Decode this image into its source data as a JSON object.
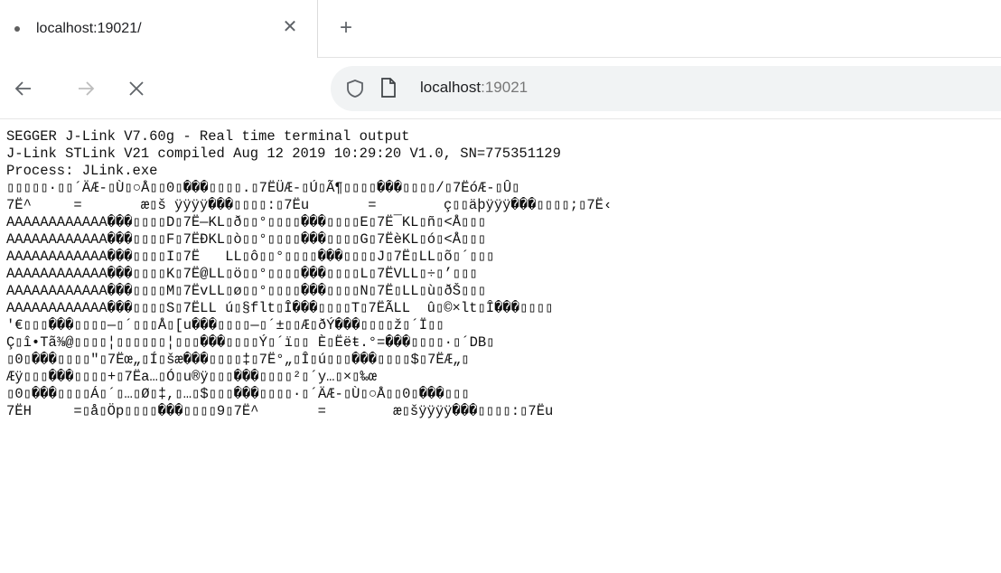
{
  "tab": {
    "title": "localhost:19021/",
    "close_icon": "close-icon",
    "new_tab_icon": "plus-icon"
  },
  "nav": {
    "back_icon": "arrow-left-icon",
    "forward_icon": "arrow-right-icon",
    "close_icon": "close-icon"
  },
  "address": {
    "host": "localhost",
    "port": ":19021",
    "security_icon": "shield-icon",
    "page_icon": "page-icon"
  },
  "terminal": {
    "lines": [
      "SEGGER J-Link V7.60g - Real time terminal output",
      "J-Link STLink V21 compiled Aug 12 2019 10:29:20 V1.0, SN=775351129",
      "Process: JLink.exe",
      "▯▯▯▯▯·▯▯´ÄÆ-▯Ù▯○Å▯▯0▯���▯▯▯▯.▯7ËÜÆ-▯Ú▯Ã¶▯▯▯▯���▯▯▯▯/▯7ËóÆ-▯Û▯",
      "7Ë^     =       æ▯š ÿÿÿÿ���▯▯▯▯:▯7Ëu       =        ç▯▯äþÿÿÿ���▯▯▯▯;▯7Ë‹",
      "AAAAAAAAAAAA���▯▯▯▯D▯7Ë—KL▯ð▯▯°▯▯▯▯���▯▯▯▯E▯7Ë¯KL▯ñ▯<Å▯▯▯",
      "AAAAAAAAAAAA���▯▯▯▯F▯7ËÐKL▯ò▯▯°▯▯▯▯���▯▯▯▯G▯7ËèKL▯ó▯<Å▯▯▯",
      "AAAAAAAAAAAA���▯▯▯▯I▯7Ë   LL▯ô▯▯°▯▯▯▯���▯▯▯▯J▯7Ë▯LL▯õ▯´▯▯▯",
      "AAAAAAAAAAAA���▯▯▯▯K▯7Ë@LL▯ö▯▯°▯▯▯▯���▯▯▯▯L▯7ËVLL▯÷▯’▯▯▯",
      "AAAAAAAAAAAA���▯▯▯▯M▯7ËvLL▯ø▯▯°▯▯▯▯���▯▯▯▯N▯7Ë▯LL▯ù▯ðŠ▯▯▯",
      "AAAAAAAAAAAA���▯▯▯▯S▯7ËLL ú▯§flt▯Î���▯▯▯▯T▯7ËÃLL  û▯©×lt▯Î���▯▯▯▯",
      "'€▯▯▯���▯▯▯▯—▯´▯▯▯Å▯[u���▯▯▯▯—▯´±▯▯Æ▯ðÝ���▯▯▯▯ž▯´Ï▯▯",
      "Ç▯î•Tã⅜@▯▯▯▯¦▯▯▯▯▯▯¦▯▯▯���▯▯▯▯Ý▯´ï▯▯ È▯Ëëŧ.°=���▯▯▯▯·▯´DB▯",
      "▯0▯���▯▯▯▯\"▯7Ëœ„▯Í▯šæ���▯▯▯▯‡▯7Ë°„▯Î▯ú▯▯▯���▯▯▯▯$▯7ËÆ„▯",
      "Æÿ▯▯▯���▯▯▯▯+▯7Ëa…▯Ó▯u®ÿ▯▯▯���▯▯▯▯²▯´y…▯×▯‰œ",
      "▯0▯���▯▯▯▯Á▯´▯…▯Ø▯‡,▯…▯$▯▯▯���▯▯▯▯·▯´ÄÆ-▯Ù▯○Å▯▯0▯���▯▯▯",
      "7ËH     =▯å▯Öp▯▯▯▯���▯▯▯▯9▯7Ë^       =        æ▯šÿÿÿÿ���▯▯▯▯:▯7Ëu"
    ]
  }
}
